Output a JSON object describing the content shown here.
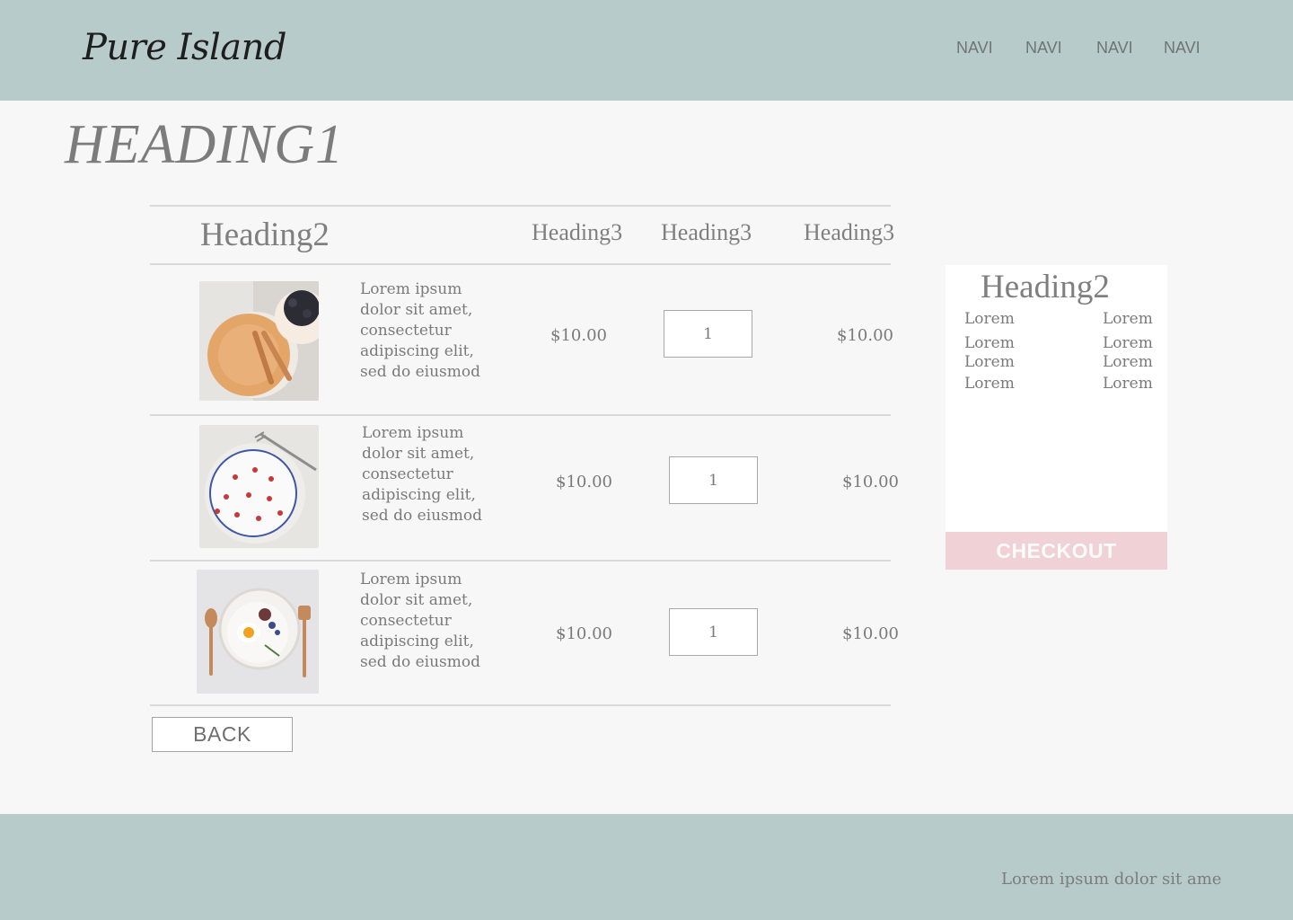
{
  "header": {
    "logo": "Pure Island",
    "nav": [
      "NAVI",
      "NAVI",
      "NAVI",
      "NAVI"
    ]
  },
  "page_title": "HEADING1",
  "table": {
    "headers": {
      "product": "Heading2",
      "col1": "Heading3",
      "col2": "Heading3",
      "col3": "Heading3"
    },
    "rows": [
      {
        "description": "Lorem ipsum dolor sit amet, consectetur adipiscing elit, sed do eiusmod",
        "price": "$10.00",
        "quantity": "1",
        "total": "$10.00"
      },
      {
        "description": "Lorem ipsum dolor sit amet, consectetur adipiscing elit, sed do eiusmod",
        "price": "$10.00",
        "quantity": "1",
        "total": "$10.00"
      },
      {
        "description": "Lorem ipsum dolor sit amet, consectetur adipiscing elit, sed do eiusmod",
        "price": "$10.00",
        "quantity": "1",
        "total": "$10.00"
      }
    ]
  },
  "back_label": "BACK",
  "summary": {
    "title": "Heading2",
    "lines": [
      [
        "Lorem",
        "Lorem"
      ],
      [
        "Lorem",
        "Lorem"
      ],
      [
        "Lorem",
        "Lorem"
      ],
      [
        "Lorem",
        "Lorem"
      ]
    ]
  },
  "checkout_label": "CHECKOUT",
  "footer_text": "Lorem ipsum dolor sit ame",
  "colors": {
    "header_bg": "#b7cbca",
    "page_bg": "#f7f7f7",
    "checkout_bg": "#f0d1d5"
  }
}
